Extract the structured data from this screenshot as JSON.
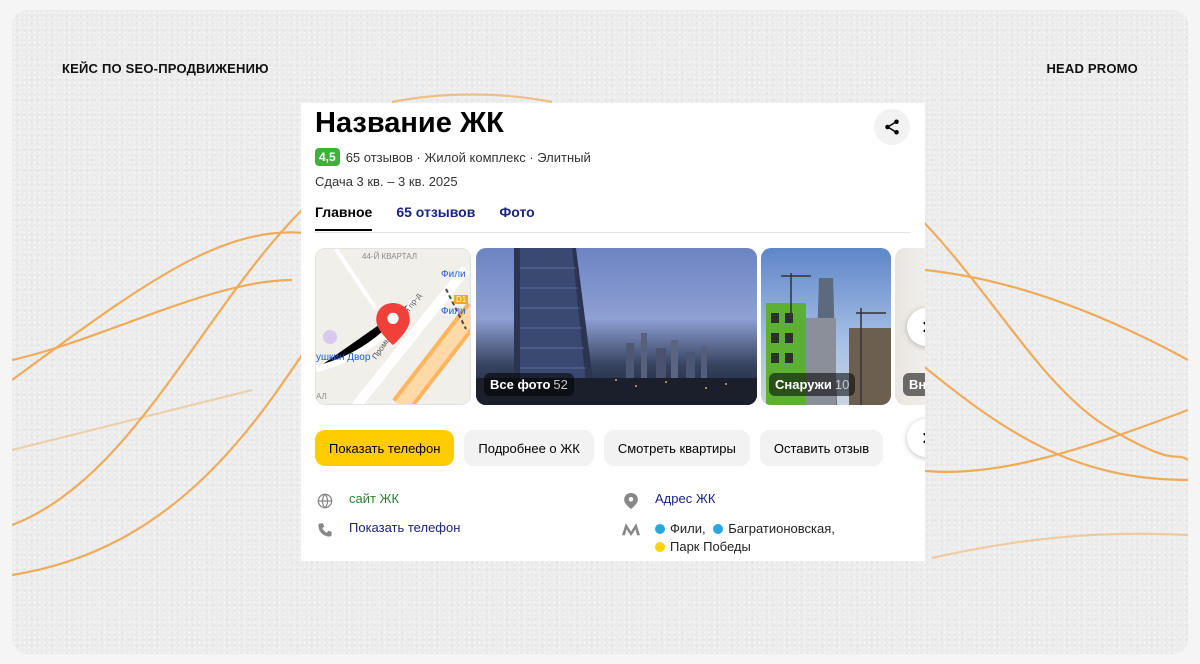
{
  "header": {
    "left_title": "КЕЙС ПО SEO-ПРОДВИЖЕНИЮ",
    "right_title": "HEAD PROMO"
  },
  "card": {
    "title": "Название ЖК",
    "rating": "4,5",
    "meta": "65 отзывов · Жилой комплекс · Элитный",
    "dates": "Сдача 3 кв. – 3 кв. 2025",
    "tabs": [
      {
        "label": "Главное",
        "active": true
      },
      {
        "label": "65 отзывов",
        "active": false
      },
      {
        "label": "Фото",
        "active": false
      }
    ],
    "map": {
      "labels": {
        "quarter": "44-Й КВАРТАЛ",
        "fili_1": "Фили",
        "fili_2": "Фили",
        "line_badge": "D1",
        "street": "Промышленный пр-д",
        "mall": "ушкин Двор",
        "cut": "АЛ"
      }
    },
    "photos": [
      {
        "label": "Все фото",
        "count": "52"
      },
      {
        "label": "Снаружи",
        "count": "10"
      },
      {
        "label": "Вн",
        "count": ""
      }
    ],
    "actions": [
      "Показать телефон",
      "Подробнее о ЖК",
      "Смотреть квартиры",
      "Оставить отзыв"
    ],
    "info": {
      "website": "сайт ЖК",
      "phone": "Показать телефон",
      "address": "Адрес ЖК",
      "metro": [
        {
          "name": "Фили,",
          "color": "#2aa7df"
        },
        {
          "name": "Багратионовская,",
          "color": "#2aa7df"
        },
        {
          "name": "Парк Победы",
          "color": "#ffd200"
        }
      ]
    }
  },
  "colors": {
    "rating_bg": "#3bb33b",
    "primary_button": "#ffcc00",
    "wave": "#f0a040",
    "link_blue": "#1a237e",
    "link_green": "#2e7d32"
  },
  "icons": [
    "share-icon",
    "chevron-right-icon",
    "globe-icon",
    "phone-icon",
    "location-pin-icon",
    "metro-icon"
  ]
}
